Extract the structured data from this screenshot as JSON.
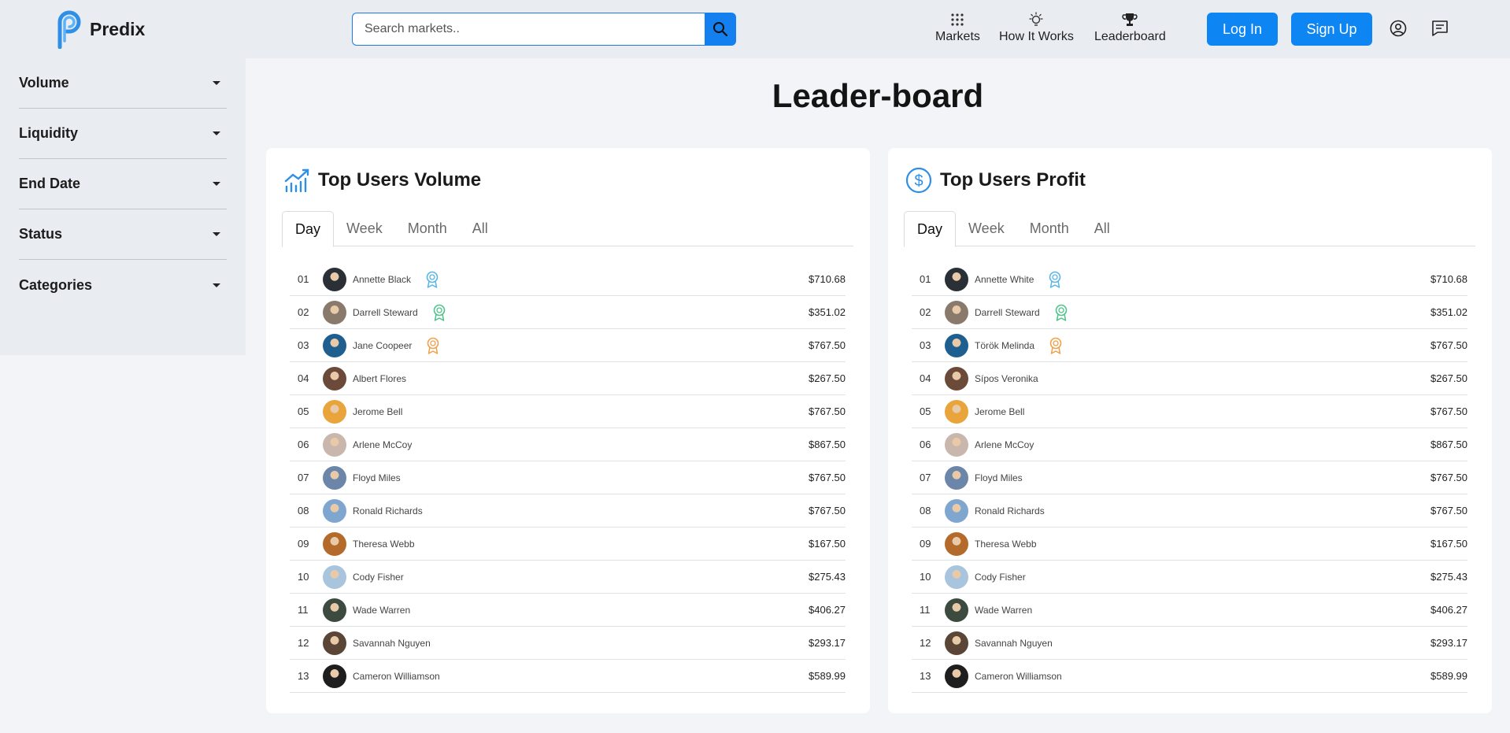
{
  "header": {
    "logo_text": "Predix",
    "search_placeholder": "Search markets..",
    "nav": [
      {
        "label": "Markets",
        "icon": "grid-icon"
      },
      {
        "label": "How It Works",
        "icon": "lightbulb-icon"
      },
      {
        "label": "Leaderboard",
        "icon": "trophy-icon"
      }
    ],
    "login_label": "Log In",
    "signup_label": "Sign Up",
    "accent_color": "#0d85f3"
  },
  "sidebar": {
    "filters": [
      "Volume",
      "Liquidity",
      "End Date",
      "Status",
      "Categories"
    ]
  },
  "page_title": "Leader-board",
  "tabs": [
    "Day",
    "Week",
    "Month",
    "All"
  ],
  "volume": {
    "title": "Top Users Volume",
    "icon": "chart-growth-icon",
    "rows": [
      {
        "rank": "01",
        "name": "Annette Black",
        "amount": "$710.68",
        "medal": "#59b6e6"
      },
      {
        "rank": "02",
        "name": "Darrell Steward",
        "amount": "$351.02",
        "medal": "#4ec48a"
      },
      {
        "rank": "03",
        "name": "Jane Coopeer",
        "amount": "$767.50",
        "medal": "#f0a04b"
      },
      {
        "rank": "04",
        "name": "Albert Flores",
        "amount": "$267.50"
      },
      {
        "rank": "05",
        "name": "Jerome Bell",
        "amount": "$767.50"
      },
      {
        "rank": "06",
        "name": "Arlene McCoy",
        "amount": "$867.50"
      },
      {
        "rank": "07",
        "name": "Floyd Miles",
        "amount": "$767.50"
      },
      {
        "rank": "08",
        "name": "Ronald Richards",
        "amount": "$767.50"
      },
      {
        "rank": "09",
        "name": "Theresa Webb",
        "amount": "$167.50"
      },
      {
        "rank": "10",
        "name": "Cody Fisher",
        "amount": "$275.43"
      },
      {
        "rank": "11",
        "name": "Wade Warren",
        "amount": "$406.27"
      },
      {
        "rank": "12",
        "name": "Savannah Nguyen",
        "amount": "$293.17"
      },
      {
        "rank": "13",
        "name": "Cameron Williamson",
        "amount": "$589.99"
      }
    ]
  },
  "profit": {
    "title": "Top Users Profit",
    "icon": "dollar-circle-icon",
    "rows": [
      {
        "rank": "01",
        "name": "Annette White",
        "amount": "$710.68",
        "medal": "#59b6e6"
      },
      {
        "rank": "02",
        "name": "Darrell Steward",
        "amount": "$351.02",
        "medal": "#4ec48a"
      },
      {
        "rank": "03",
        "name": "Török Melinda",
        "amount": "$767.50",
        "medal": "#f0a04b"
      },
      {
        "rank": "04",
        "name": "Sípos Veronika",
        "amount": "$267.50"
      },
      {
        "rank": "05",
        "name": "Jerome Bell",
        "amount": "$767.50"
      },
      {
        "rank": "06",
        "name": "Arlene McCoy",
        "amount": "$867.50"
      },
      {
        "rank": "07",
        "name": "Floyd Miles",
        "amount": "$767.50"
      },
      {
        "rank": "08",
        "name": "Ronald Richards",
        "amount": "$767.50"
      },
      {
        "rank": "09",
        "name": "Theresa Webb",
        "amount": "$167.50"
      },
      {
        "rank": "10",
        "name": "Cody Fisher",
        "amount": "$275.43"
      },
      {
        "rank": "11",
        "name": "Wade Warren",
        "amount": "$406.27"
      },
      {
        "rank": "12",
        "name": "Savannah Nguyen",
        "amount": "$293.17"
      },
      {
        "rank": "13",
        "name": "Cameron Williamson",
        "amount": "$589.99"
      }
    ]
  },
  "avatar_colors": [
    "#2b2f36",
    "#8a7a6c",
    "#1f5f8f",
    "#6b4a3a",
    "#e9a43b",
    "#c9b7ad",
    "#6b86a8",
    "#7fa6cf",
    "#b36a2b",
    "#a9c4dd",
    "#3c4a3f",
    "#5a4536",
    "#1e1e1e"
  ]
}
